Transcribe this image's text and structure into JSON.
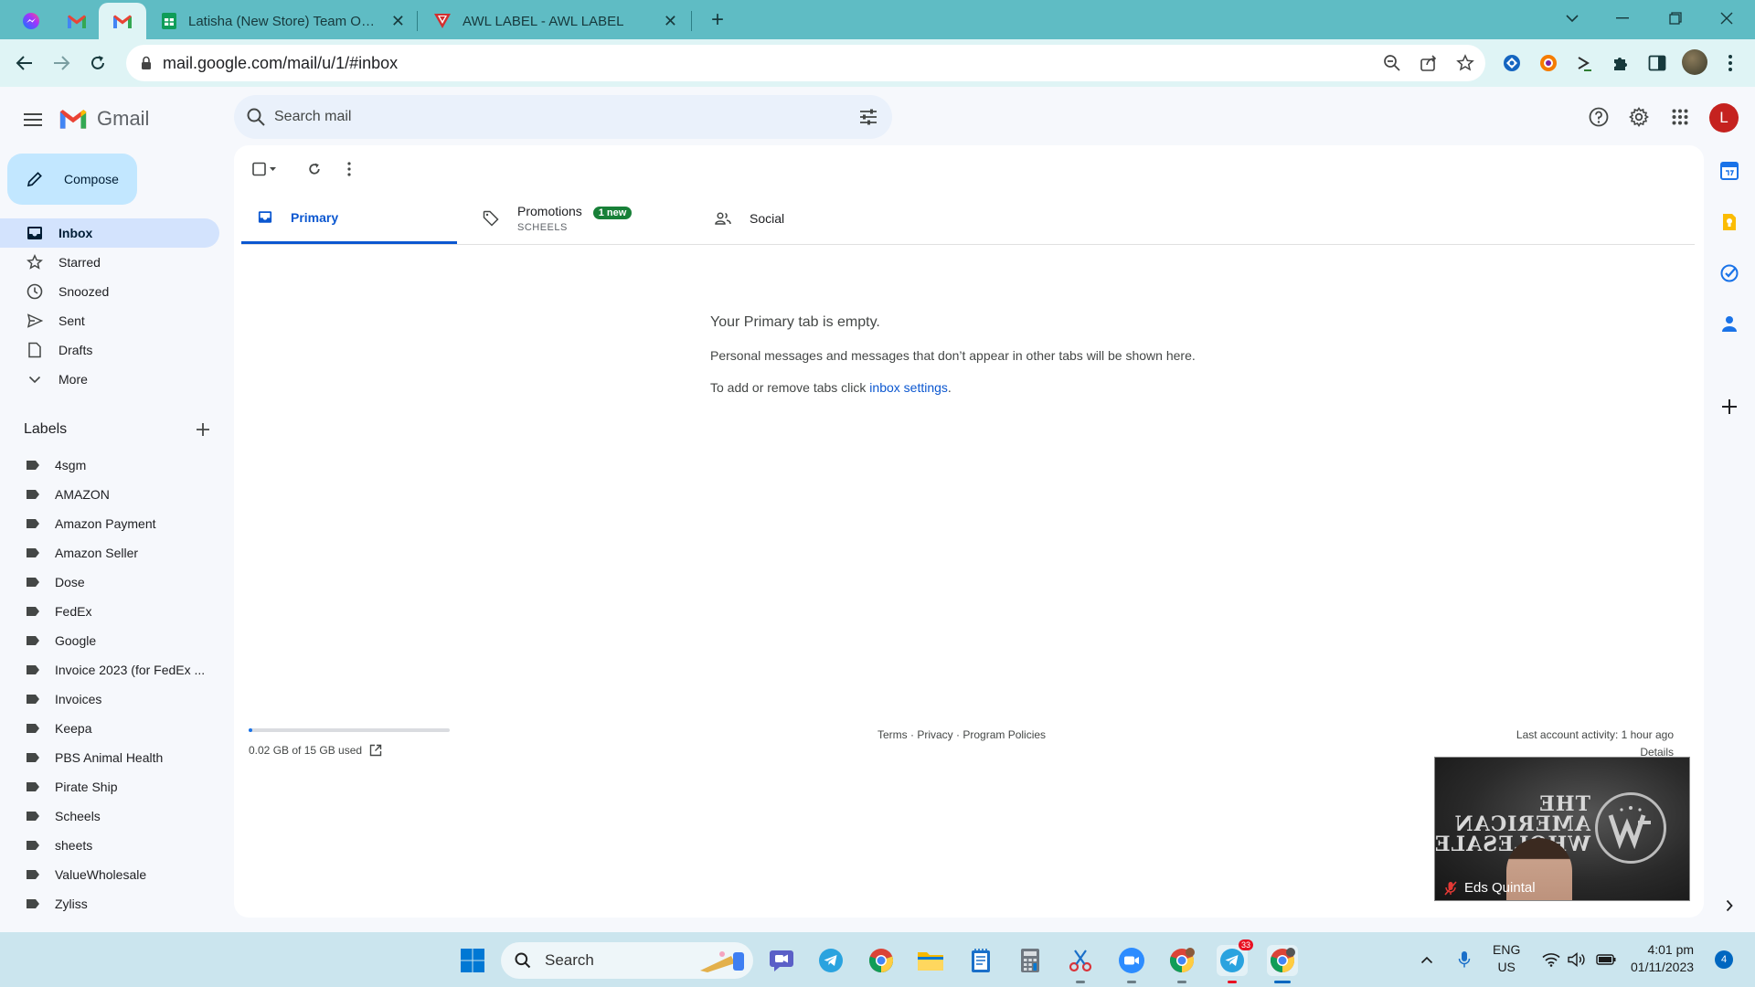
{
  "browser": {
    "tabs": [
      {
        "title": "Latisha (New Store) Team Only -",
        "icon": "google-sheets-icon"
      },
      {
        "title": "AWL LABEL - AWL LABEL",
        "icon": "awl-logo-icon"
      }
    ],
    "pinned_tabs": [
      "messenger-icon",
      "gmail-icon",
      "gmail-icon"
    ],
    "url": "mail.google.com/mail/u/1/#inbox"
  },
  "gmail": {
    "product_name": "Gmail",
    "search_placeholder": "Search mail",
    "avatar_letter": "L",
    "compose_label": "Compose",
    "nav": [
      {
        "label": "Inbox",
        "icon": "inbox-icon",
        "active": true
      },
      {
        "label": "Starred",
        "icon": "star-icon"
      },
      {
        "label": "Snoozed",
        "icon": "clock-icon"
      },
      {
        "label": "Sent",
        "icon": "send-icon"
      },
      {
        "label": "Drafts",
        "icon": "draft-icon"
      },
      {
        "label": "More",
        "icon": "chevron-down-icon"
      }
    ],
    "labels_heading": "Labels",
    "labels": [
      "4sgm",
      "AMAZON",
      "Amazon Payment",
      "Amazon Seller",
      "Dose",
      "FedEx",
      "Google",
      "Invoice 2023 (for FedEx ...",
      "Invoices",
      "Keepa",
      "PBS Animal Health",
      "Pirate Ship",
      "Scheels",
      "sheets",
      "ValueWholesale",
      "Zyliss"
    ],
    "tabs": {
      "primary": "Primary",
      "promotions": "Promotions",
      "promotions_badge": "1 new",
      "promotions_sub": "SCHEELS",
      "social": "Social"
    },
    "empty": {
      "title": "Your Primary tab is empty.",
      "desc": "Personal messages and messages that don’t appear in other tabs will be shown here.",
      "hint_prefix": "To add or remove tabs click ",
      "hint_link": "inbox settings",
      "hint_suffix": "."
    },
    "storage": {
      "text": "0.02 GB of 15 GB used",
      "fraction": 0.0013
    },
    "footer": {
      "terms": "Terms",
      "privacy": "Privacy",
      "policies": "Program Policies",
      "separator": " · "
    },
    "last_activity": "Last account activity: 1 hour ago",
    "details": "Details"
  },
  "video_call": {
    "participant": "Eds Quintal",
    "background_text": "THE AMERICAN WHOLESALERS",
    "muted": true
  },
  "taskbar": {
    "search_label": "Search",
    "apps": [
      "windows-start-icon",
      "teams-chat-icon",
      "telegram-icon",
      "chrome-icon",
      "file-explorer-icon",
      "notepad-icon",
      "calculator-icon",
      "snipping-tool-icon",
      "zoom-icon",
      "chrome-icon",
      "telegram-icon",
      "chrome-icon"
    ],
    "telegram_badge": "33",
    "lang_line1": "ENG",
    "lang_line2": "US",
    "time": "4:01 pm",
    "date": "01/11/2023",
    "notifications": "4"
  },
  "colors": {
    "accent": "#0b57d0",
    "compose_bg": "#c2e7ff",
    "nav_active": "#d3e3fd",
    "page_bg": "#f6f8fc",
    "browser_frame": "#5fbcc4",
    "avatar_bg": "#c5221f",
    "badge_green": "#188038"
  }
}
